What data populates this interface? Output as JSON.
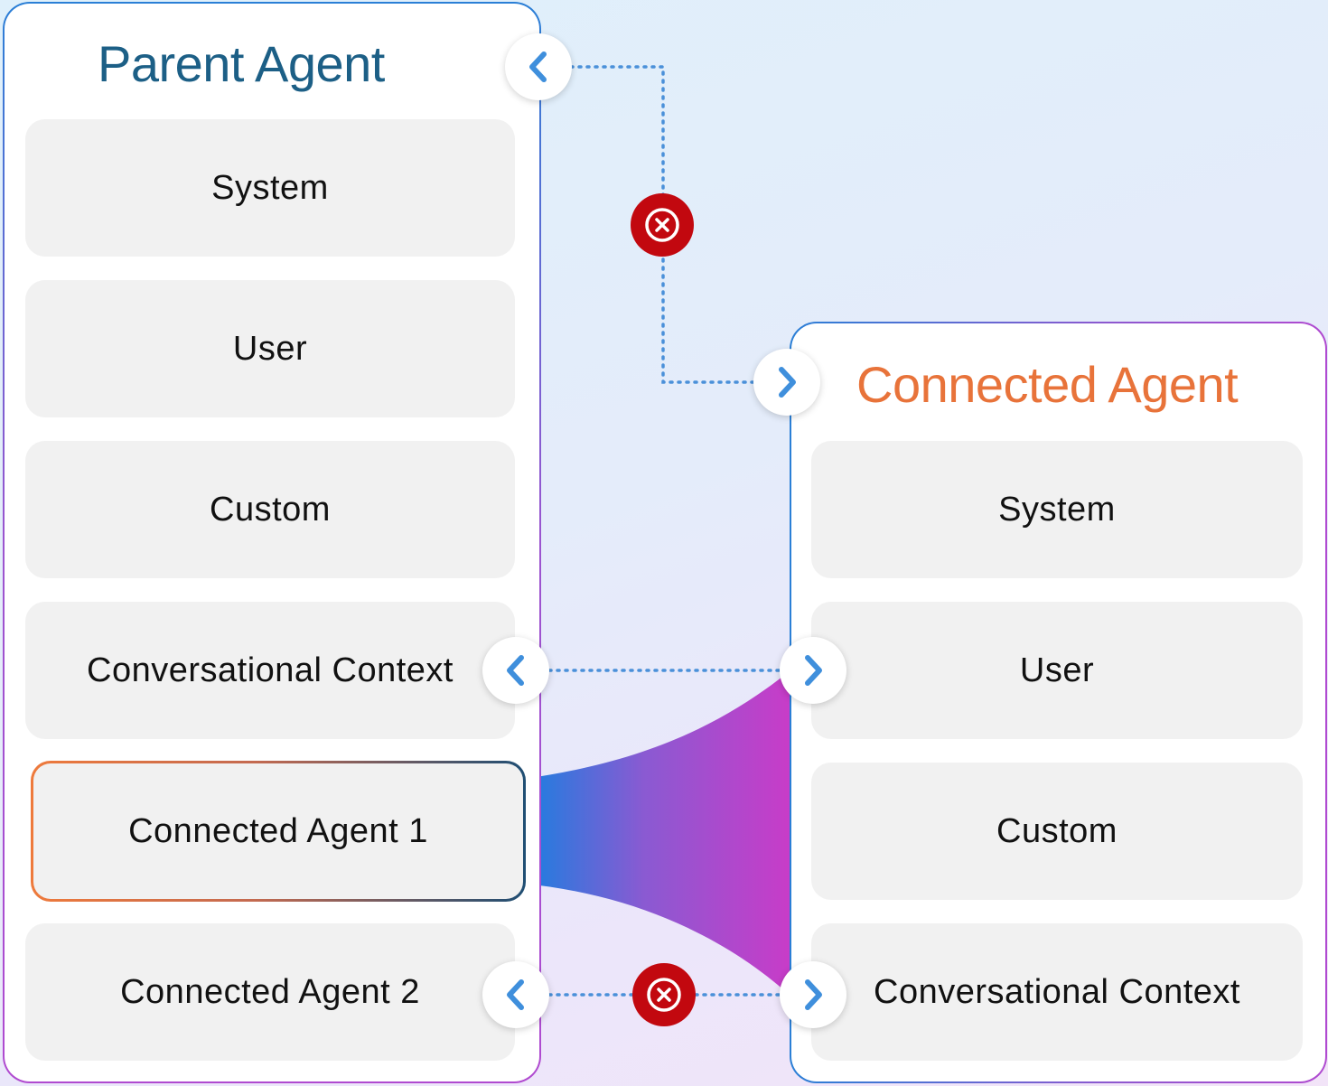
{
  "parent_agent": {
    "title": "Parent Agent",
    "items": [
      {
        "label": "System"
      },
      {
        "label": "User"
      },
      {
        "label": "Custom"
      },
      {
        "label": "Conversational Context"
      },
      {
        "label": "Connected Agent 1"
      },
      {
        "label": "Connected Agent 2"
      }
    ]
  },
  "connected_agent": {
    "title": "Connected Agent",
    "items": [
      {
        "label": "System"
      },
      {
        "label": "User"
      },
      {
        "label": "Custom"
      },
      {
        "label": "Conversational Context"
      }
    ]
  },
  "colors": {
    "parent_title": "#1c5f86",
    "connected_title": "#e8733a",
    "blocked_badge": "#c2080f",
    "connector_dots": "#4a90d9",
    "flow_gradient_start": "#1a7fe0",
    "flow_gradient_end": "#c83cc8"
  },
  "icons": {
    "left_arrow": "chevron-left-icon",
    "right_arrow": "chevron-right-icon",
    "blocked": "close-circle-icon"
  }
}
